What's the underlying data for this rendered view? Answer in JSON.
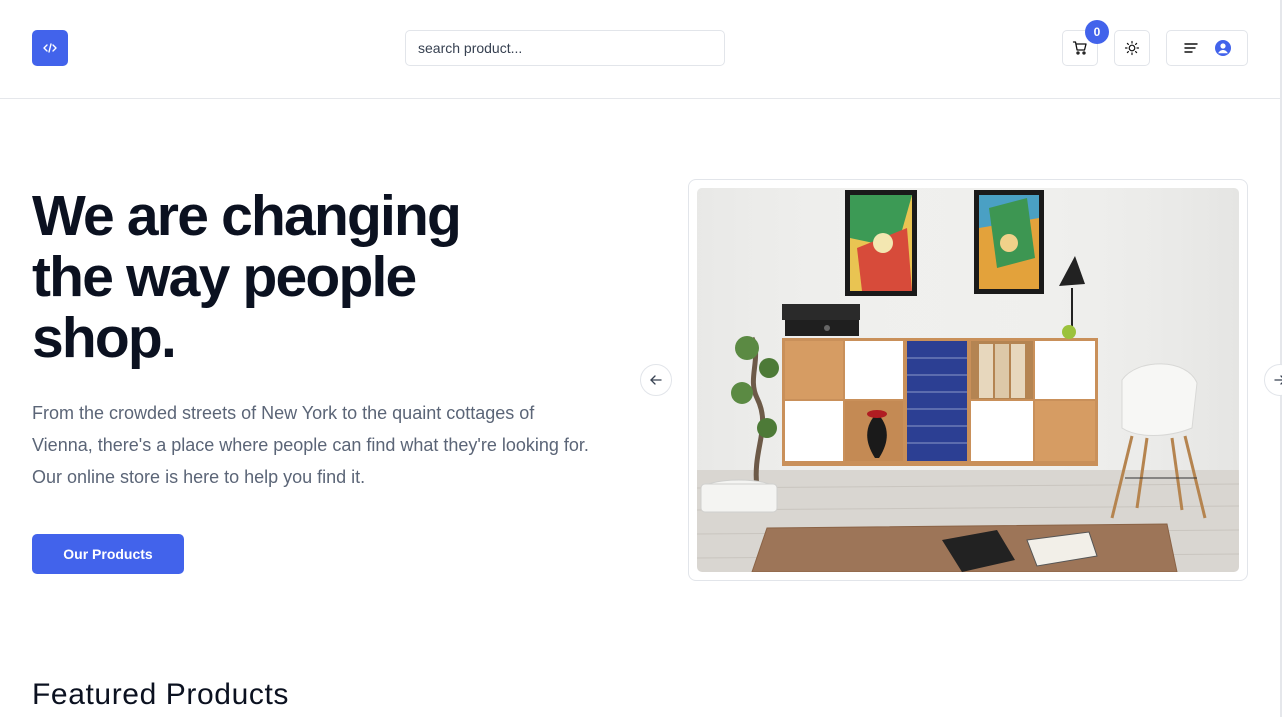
{
  "header": {
    "search_placeholder": "search product...",
    "cart_count": "0",
    "icons": {
      "logo": "code-icon",
      "cart": "cart-icon",
      "theme": "sun-icon",
      "menu": "menu-icon",
      "user": "user-icon"
    }
  },
  "hero": {
    "title_lines": [
      "We are changing",
      "the way people",
      "shop."
    ],
    "description": "From the crowded streets of New York to the quaint cottages of Vienna, there's a place where people can find what they're looking for. Our online store is here to help you find it.",
    "cta_label": "Our Products"
  },
  "carousel": {
    "prev_icon": "arrow-left-icon",
    "next_icon": "arrow-right-icon"
  },
  "featured": {
    "title": "Featured Products"
  },
  "colors": {
    "accent": "#4263eb",
    "text": "#0b1120",
    "muted": "#5b6577",
    "border": "#e2e5ea"
  }
}
